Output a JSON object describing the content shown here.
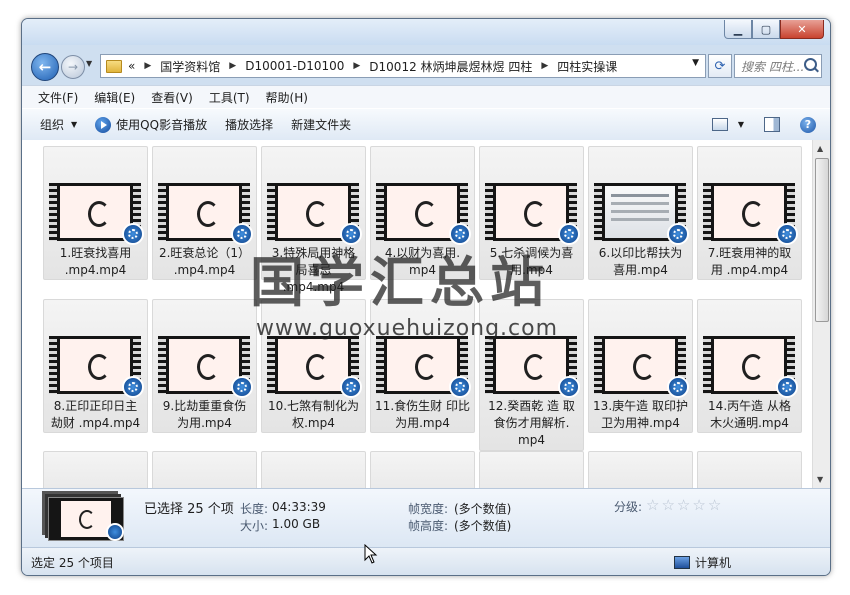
{
  "window": {
    "controls": {
      "minimize": "▁",
      "maximize": "▢",
      "close": "✕"
    }
  },
  "address": {
    "overflow": "«",
    "crumbs": [
      "国学资料馆",
      "D10001-D10100",
      "D10012 林炳坤晨煜林煜 四柱",
      "四柱实操课"
    ]
  },
  "search": {
    "placeholder": "搜索 四柱..."
  },
  "menubar": [
    "文件(F)",
    "编辑(E)",
    "查看(V)",
    "工具(T)",
    "帮助(H)"
  ],
  "toolbar": {
    "organize": "组织",
    "qq_play": "使用QQ影音播放",
    "play_selected": "播放选择",
    "new_folder": "新建文件夹",
    "help": "?"
  },
  "files": [
    {
      "name": "1.旺衰找喜用\n.mp4.mp4",
      "thumb": "logo"
    },
    {
      "name": "2.旺衰总论（1）\n.mp4.mp4",
      "thumb": "logo"
    },
    {
      "name": "3.特殊局用神格\n局喜忌\n.mp4.mp4",
      "thumb": "logo"
    },
    {
      "name": "4.以财为喜用.\nmp4",
      "thumb": "logo"
    },
    {
      "name": "5.七杀调候为喜\n用.mp4",
      "thumb": "logo"
    },
    {
      "name": "6.以印比帮扶为\n喜用.mp4",
      "thumb": "slide"
    },
    {
      "name": "7.旺衰用神的取\n用 .mp4.mp4",
      "thumb": "logo"
    },
    {
      "name": "8.正印正印日主\n劫财 .mp4.mp4",
      "thumb": "logo"
    },
    {
      "name": "9.比劫重重食伤\n为用.mp4",
      "thumb": "logo"
    },
    {
      "name": "10.七煞有制化为\n权.mp4",
      "thumb": "logo"
    },
    {
      "name": "11.食伤生财 印比\n为用.mp4",
      "thumb": "logo"
    },
    {
      "name": "12.癸酉乾 造 取\n食伤才用解析.\nmp4",
      "thumb": "logo"
    },
    {
      "name": "13.庚午造 取印护\n卫为用神.mp4",
      "thumb": "logo"
    },
    {
      "name": "14.丙午造 从格\n木火通明.mp4",
      "thumb": "logo"
    }
  ],
  "watermark": {
    "title": "国学汇总站",
    "url": "www.guoxuehuizong.com"
  },
  "details": {
    "selected": "已选择 25 个项",
    "length_label": "长度:",
    "length_value": "04:33:39",
    "size_label": "大小:",
    "size_value": "1.00 GB",
    "frame_width_label": "帧宽度:",
    "frame_width_value": "(多个数值)",
    "frame_height_label": "帧高度:",
    "frame_height_value": "(多个数值)",
    "rating_label": "分级:",
    "rating_stars": 0
  },
  "status": {
    "text": "选定 25 个项目",
    "location": "计算机"
  }
}
